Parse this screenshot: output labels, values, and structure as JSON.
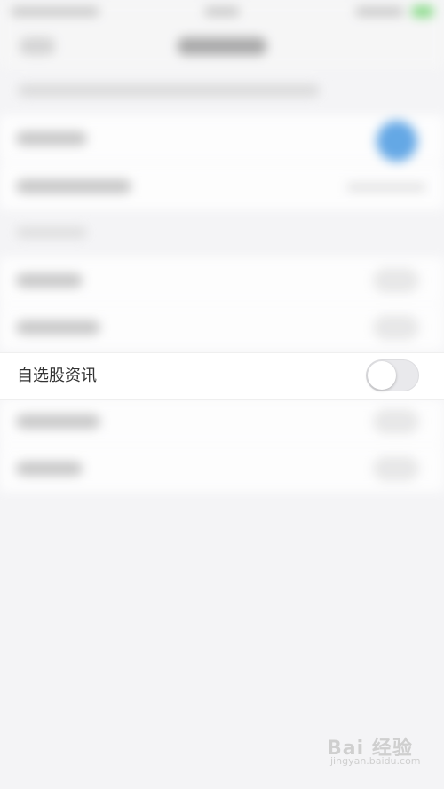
{
  "focused_setting": {
    "label": "自选股资讯",
    "enabled": false
  },
  "watermark": {
    "brand": "Bai 经验",
    "domain": "jingyan.baidu.com"
  }
}
